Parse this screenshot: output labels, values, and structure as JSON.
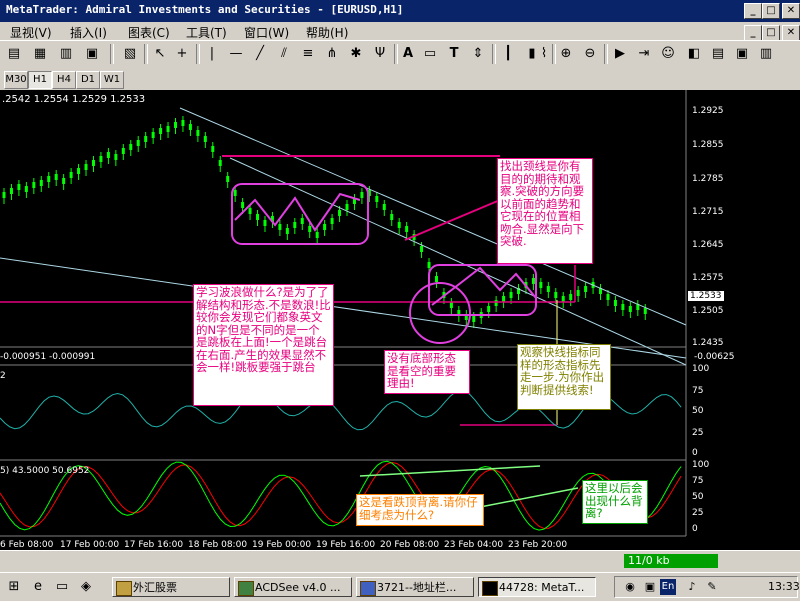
{
  "window": {
    "title": "MetaTrader: Admiral Investments and Securities - [EURUSD,H1]",
    "min_label": "_",
    "max_label": "□",
    "close_label": "✕"
  },
  "menu": {
    "items": [
      "显视(V)",
      "插入(I)",
      "图表(C)",
      "工具(T)",
      "窗口(W)",
      "帮助(H)"
    ],
    "win_min": "_",
    "win_max": "□",
    "win_close": "✕"
  },
  "toolbar": {
    "icons": [
      "panel-icon",
      "grid-icon",
      "new-chart-icon",
      "save-icon",
      "cursor-icon",
      "crosshair-icon",
      "vline-icon",
      "hline-icon",
      "trendline-icon",
      "channel-icon",
      "fib-icon",
      "gann-icon",
      "text-icon",
      "label-icon",
      "arrow-icon",
      "zoom-in-icon",
      "zoom-out-icon",
      "autoscroll-icon",
      "expert-icon",
      "bar-chart-icon",
      "candle-chart-icon",
      "line-chart-icon"
    ],
    "text_label": "A",
    "text2_label": "T"
  },
  "timeframes": [
    "M30",
    "H1",
    "H4",
    "D1",
    "W1"
  ],
  "selected_timeframe": "H1",
  "chart": {
    "ohlc_text": ".2542 1.2554 1.2529 1.2533",
    "price_ticks": [
      "1.2925",
      "1.2855",
      "1.2785",
      "1.2715",
      "1.2645",
      "1.2575",
      "1.2505",
      "1.2435"
    ],
    "current_price": "1.2533",
    "osc1_left": "-0.000951 -0.000991",
    "osc1_right": "-0.00625",
    "osc2_label": "2",
    "osc2_ticks": [
      "100",
      "75",
      "50",
      "25",
      "0"
    ],
    "osc3_label": "5) 43.5000 50.6952",
    "osc3_ticks": [
      "100",
      "75",
      "50",
      "25",
      "0"
    ],
    "time_labels": [
      "6 Feb 08:00",
      "17 Feb 00:00",
      "17 Feb 16:00",
      "18 Feb 08:00",
      "19 Feb 00:00",
      "19 Feb 16:00",
      "20 Feb 08:00",
      "23 Feb 04:00",
      "23 Feb 20:00"
    ]
  },
  "annotations": {
    "neckline": "找出颈线是你有目的的期待和观察.突破的方向要以前面的趋势和它现在的位置相吻合.显然是向下突破.",
    "wave": "学习波浪做什么?是为了了解结构和形态.不是数浪!比较你会发现它们都象英文的N字但是不同的是一个是跳板在上面!一个是跳台在右面.产生的效果显然不会一样!跳板要强于跳台",
    "bottom": "没有底部形态是看空的重要理由!",
    "indicator": "观察快线指标同样的形态指标先走一步.为你作出判断提供线索!",
    "divergence": "这是看跌顶背离.请你仔细考虑为什么?",
    "future": "这里以后会出现什么背离?"
  },
  "status": {
    "kb": "11/0 kb"
  },
  "taskbar": {
    "items": [
      "外汇股票",
      "ACDSee v4.0 ...",
      "3721--地址栏...",
      "44728: MetaT..."
    ],
    "clock": "13:33",
    "lang": "En"
  },
  "colors": {
    "candle": "#00ff00",
    "annotation": "#e6007e",
    "trendline": "#add8e6",
    "osc_line": "#20b2aa",
    "stoch_main": "#00ff00",
    "stoch_signal": "#ff0000"
  }
}
